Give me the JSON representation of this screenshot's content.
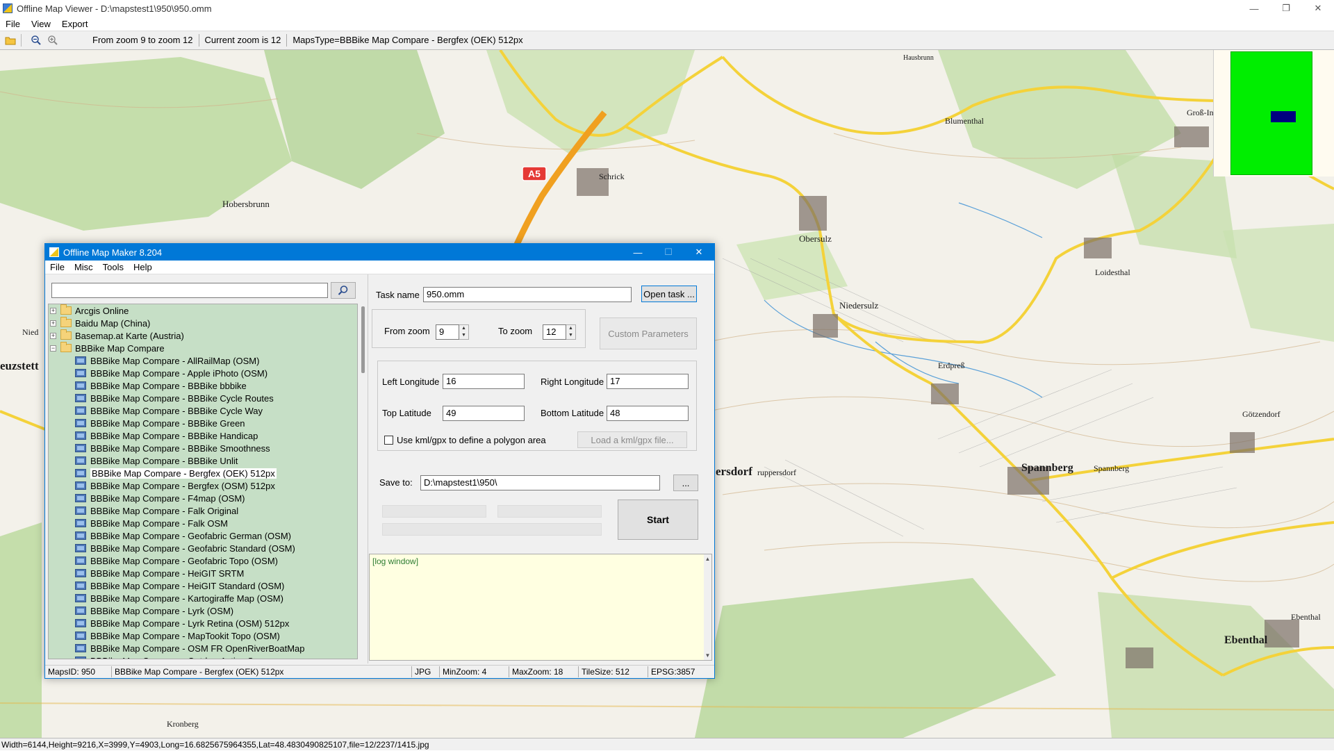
{
  "viewer": {
    "title": "Offline Map Viewer - D:\\mapstest1\\950\\950.omm",
    "window_controls": {
      "minimize": "—",
      "maximize": "❐",
      "close": "✕"
    },
    "menu": [
      "File",
      "View",
      "Export"
    ],
    "toolbar": {
      "zoom_range": "From zoom 9 to zoom 12",
      "current_zoom": "Current zoom is 12",
      "maps_type": "MapsType=BBBike Map Compare - Bergfex (OEK) 512px"
    },
    "status": "Width=6144,Height=9216,X=3999,Y=4903,Long=16.6825675964355,Lat=48.4830490825107,file=12/2237/1415.jpg",
    "map_labels": [
      {
        "text": "A5",
        "kind": "motorway-shield"
      },
      {
        "text": "Schrick",
        "kind": "town"
      },
      {
        "text": "Obersulz",
        "kind": "town"
      },
      {
        "text": "Niedersulz",
        "kind": "town"
      },
      {
        "text": "Loidesthal",
        "kind": "town"
      },
      {
        "text": "Spannberg",
        "kind": "town-large"
      },
      {
        "text": "Spannberg",
        "kind": "town"
      },
      {
        "text": "Ebenthal",
        "kind": "town-large"
      },
      {
        "text": "Ebenthal",
        "kind": "town"
      },
      {
        "text": "Götzendorf",
        "kind": "town"
      },
      {
        "text": "Erdpreß",
        "kind": "town"
      },
      {
        "text": "Blumenthal",
        "kind": "town"
      },
      {
        "text": "Hobersbrunn",
        "kind": "town"
      },
      {
        "text": "ersdorf",
        "kind": "town-large"
      },
      {
        "text": "ruppersdorf",
        "kind": "town"
      },
      {
        "text": "euzstett",
        "kind": "town-large"
      },
      {
        "text": "Nied",
        "kind": "town"
      },
      {
        "text": "Kronberg",
        "kind": "town"
      },
      {
        "text": "Groß-In",
        "kind": "town"
      },
      {
        "text": "Hausbrunn",
        "kind": "town"
      }
    ]
  },
  "maker": {
    "title": "Offline Map Maker 8.204",
    "window_controls": {
      "minimize": "—",
      "maximize": "☐",
      "close": "✕"
    },
    "menu": [
      "File",
      "Misc",
      "Tools",
      "Help"
    ],
    "search": {
      "value": "",
      "placeholder": ""
    },
    "tree": {
      "folders": [
        {
          "label": "Arcgis Online",
          "expanded": false
        },
        {
          "label": "Baidu Map (China)",
          "expanded": false
        },
        {
          "label": "Basemap.at Karte (Austria)",
          "expanded": false
        },
        {
          "label": "BBBike Map Compare",
          "expanded": true
        }
      ],
      "children": [
        "BBBike Map Compare - AllRailMap (OSM)",
        "BBBike Map Compare - Apple iPhoto (OSM)",
        "BBBike Map Compare - BBBike bbbike",
        "BBBike Map Compare - BBBike Cycle Routes",
        "BBBike Map Compare - BBBike Cycle Way",
        "BBBike Map Compare - BBBike Green",
        "BBBike Map Compare - BBBike Handicap",
        "BBBike Map Compare - BBBike Smoothness",
        "BBBike Map Compare - BBBike Unlit",
        "BBBike Map Compare - Bergfex (OEK) 512px",
        "BBBike Map Compare - Bergfex (OSM) 512px",
        "BBBike Map Compare - F4map (OSM)",
        "BBBike Map Compare - Falk Original",
        "BBBike Map Compare - Falk OSM",
        "BBBike Map Compare - Geofabric German (OSM)",
        "BBBike Map Compare - Geofabric Standard (OSM)",
        "BBBike Map Compare - Geofabric Topo (OSM)",
        "BBBike Map Compare - HeiGIT SRTM",
        "BBBike Map Compare - HeiGIT Standard (OSM)",
        "BBBike Map Compare - Kartogiraffe Map (OSM)",
        "BBBike Map Compare - Lyrk (OSM)",
        "BBBike Map Compare - Lyrk Retina (OSM) 512px",
        "BBBike Map Compare - MapTookit Topo (OSM)",
        "BBBike Map Compare - OSM FR OpenRiverBoatMap",
        "BBBike Map Compare - OutdoorActive Summer"
      ],
      "selected": "BBBike Map Compare - Bergfex (OEK) 512px"
    },
    "task": {
      "label": "Task name",
      "value": "950.omm",
      "open_button": "Open task ..."
    },
    "zoom": {
      "from_label": "From zoom",
      "from_value": "9",
      "to_label": "To zoom",
      "to_value": "12",
      "custom_button": "Custom Parameters"
    },
    "bounds": {
      "left_label": "Left Longitude",
      "left_value": "16",
      "right_label": "Right Longitude",
      "right_value": "17",
      "top_label": "Top Latitude",
      "top_value": "49",
      "bottom_label": "Bottom Latitude",
      "bottom_value": "48",
      "kml_checkbox_label": "Use kml/gpx to define a polygon area",
      "kml_checked": false,
      "load_kml_button": "Load a kml/gpx file..."
    },
    "save": {
      "label": "Save to:",
      "value": "D:\\mapstest1\\950\\",
      "browse_button": "...",
      "start_button": "Start"
    },
    "log": "[log window]",
    "status": {
      "maps_id": "MapsID: 950",
      "map_name": "BBBike Map Compare - Bergfex (OEK) 512px",
      "format": "JPG",
      "min_zoom": "MinZoom: 4",
      "max_zoom": "MaxZoom: 18",
      "tile_size": "TileSize: 512",
      "epsg": "EPSG:3857"
    }
  },
  "colors": {
    "titlebar_active": "#0078d7",
    "tree_bg": "#c6dfc6",
    "log_bg": "#ffffe1",
    "log_text": "#2e7d32",
    "minimap_green": "#00ee00",
    "minimap_view": "#000080",
    "road_yellow": "#f4d23a",
    "motorway_orange": "#f0a020",
    "forest_green": "#a9d18e"
  }
}
